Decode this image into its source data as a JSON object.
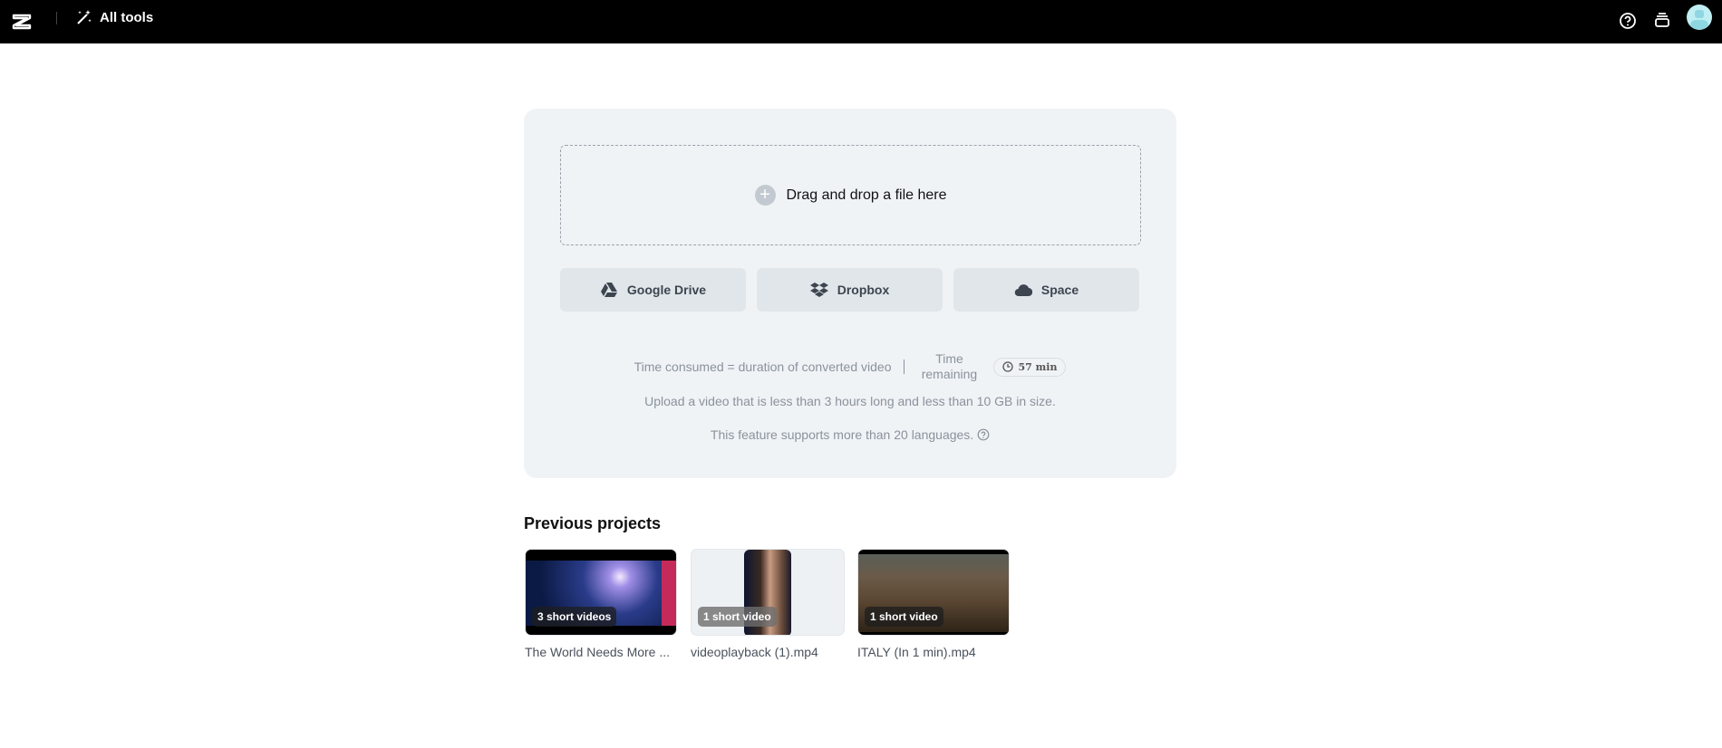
{
  "topbar": {
    "all_tools": "All tools"
  },
  "upload": {
    "drop_label": "Drag and drop a file here",
    "sources": [
      {
        "label": "Google Drive",
        "icon": "google-drive-icon"
      },
      {
        "label": "Dropbox",
        "icon": "dropbox-icon"
      },
      {
        "label": "Space",
        "icon": "cloud-icon"
      }
    ],
    "time_consumed": "Time consumed = duration of converted video",
    "time_remaining_label": "Time remaining",
    "time_remaining_value": "57 min",
    "size_limit": "Upload a video that is less than 3 hours long and less than 10 GB in size.",
    "languages": "This feature supports more than 20 languages."
  },
  "previous": {
    "title": "Previous projects",
    "projects": [
      {
        "name": "The World Needs More ...",
        "badge": "3 short videos"
      },
      {
        "name": "videoplayback (1).mp4",
        "badge": "1 short video"
      },
      {
        "name": "ITALY (In 1 min).mp4",
        "badge": "1 short video"
      }
    ]
  }
}
